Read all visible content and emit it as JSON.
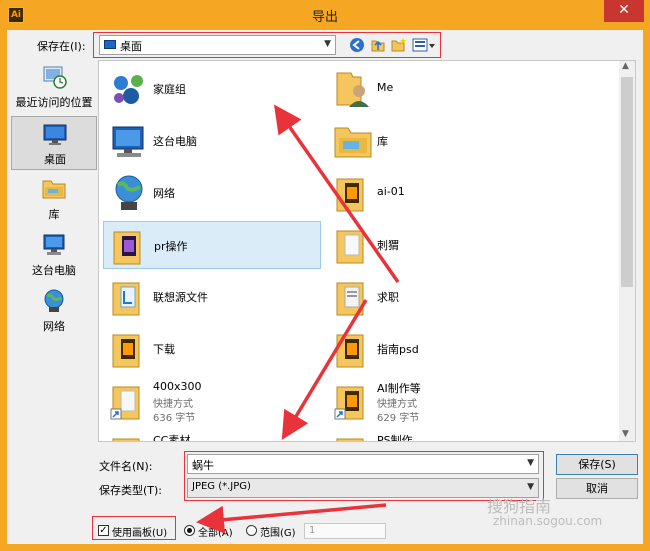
{
  "titlebar": {
    "app_icon": "Ai",
    "title": "导出",
    "close": "✕"
  },
  "toolbar": {
    "save_in_label": "保存在(I):",
    "location": "桌面"
  },
  "places": [
    {
      "label": "最近访问的位置",
      "icon": "recent-places-icon"
    },
    {
      "label": "桌面",
      "icon": "desktop-icon"
    },
    {
      "label": "库",
      "icon": "libraries-icon"
    },
    {
      "label": "这台电脑",
      "icon": "this-pc-icon"
    },
    {
      "label": "网络",
      "icon": "network-icon"
    }
  ],
  "files": [
    {
      "name": "家庭组",
      "icon": "homegroup-icon"
    },
    {
      "name": "Me",
      "icon": "user-folder-icon"
    },
    {
      "name": "这台电脑",
      "icon": "computer-icon"
    },
    {
      "name": "库",
      "icon": "library-folder-icon"
    },
    {
      "name": "网络",
      "icon": "network-globe-icon"
    },
    {
      "name": "ai-01",
      "icon": "folder-icon"
    },
    {
      "name": "pr操作",
      "icon": "folder-icon"
    },
    {
      "name": "刺猬",
      "icon": "folder-icon"
    },
    {
      "name": "联想源文件",
      "icon": "folder-icon"
    },
    {
      "name": "求职",
      "icon": "folder-icon"
    },
    {
      "name": "下载",
      "icon": "folder-icon"
    },
    {
      "name": "指南psd",
      "icon": "folder-icon"
    },
    {
      "name": "400x300",
      "type": "快捷方式",
      "size": "636 字节",
      "icon": "shortcut-folder-icon"
    },
    {
      "name": "AI制作等",
      "type": "快捷方式",
      "size": "629 字节",
      "icon": "shortcut-ai-icon"
    },
    {
      "name": "CC素材",
      "icon": "folder-icon"
    },
    {
      "name": "PS制作",
      "icon": "folder-icon"
    }
  ],
  "form": {
    "filename_label": "文件名(N):",
    "filename_value": "蜗牛",
    "filetype_label": "保存类型(T):",
    "filetype_value": "JPEG (*.JPG)",
    "save_button": "保存(S)",
    "cancel_button": "取消"
  },
  "options": {
    "use_artboards": "使用画板(U)",
    "all": "全部(A)",
    "range": "范围(G)",
    "range_value": "1"
  },
  "watermark": {
    "text": "zhinan.sogou.com",
    "brand": "搜狗指南"
  }
}
